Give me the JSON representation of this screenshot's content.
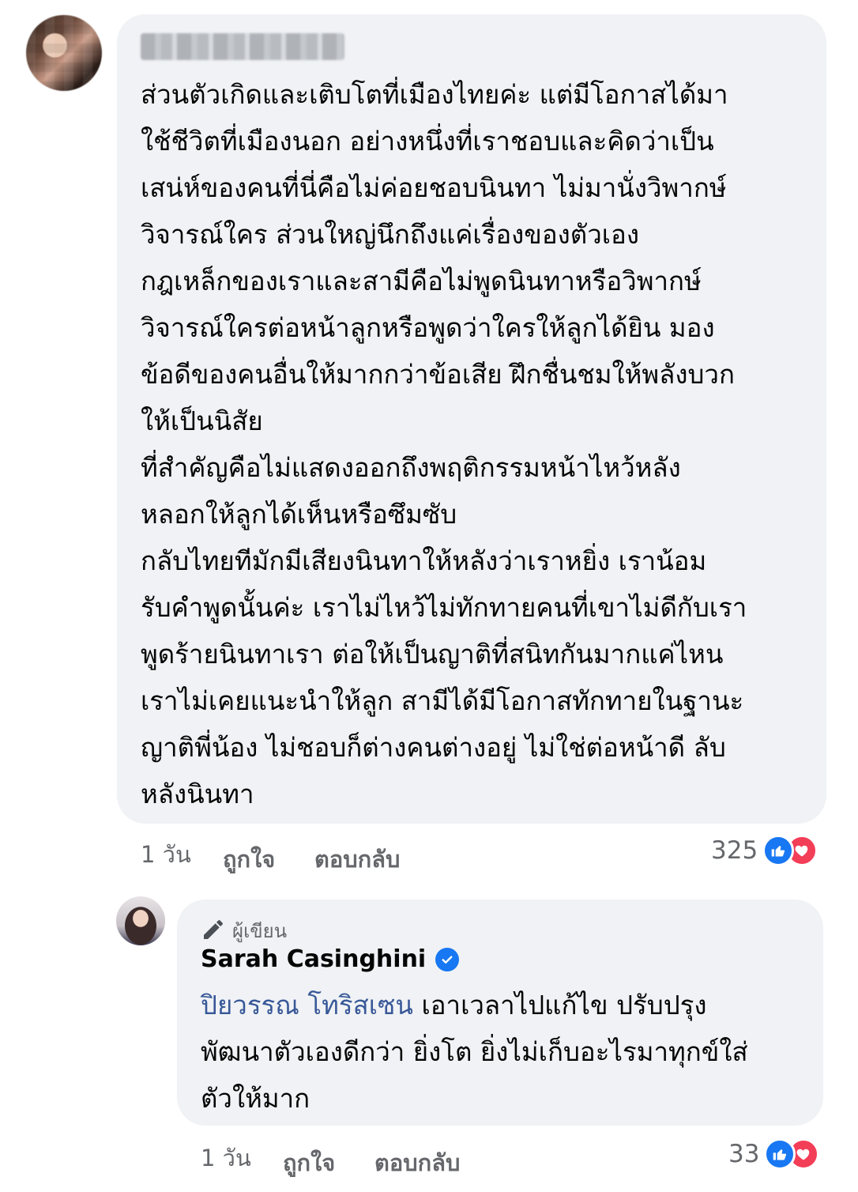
{
  "comment": {
    "author_name_blurred": "",
    "text": "ส่วนตัวเกิดและเติบโตที่เมืองไทยค่ะ แต่มีโอกาสได้มา\nใช้ชีวิตที่เมืองนอก อย่างหนึ่งที่เราชอบและคิดว่าเป็น\nเสน่ห์ของคนที่นี่คือไม่ค่อยชอบนินทา ไม่มานั่งวิพากษ์\nวิจารณ์ใคร ส่วนใหญ่นึกถึงแค่เรื่องของตัวเอง\nกฎเหล็กของเราและสามีคือไม่พูดนินทาหรือวิพากษ์\nวิจารณ์ใครต่อหน้าลูกหรือพูดว่าใครให้ลูกได้ยิน มอง\nข้อดีของคนอื่นให้มากกว่าข้อเสีย ฝึกชื่นชมให้พลังบวก\nให้เป็นนิสัย\nที่สำคัญคือไม่แสดงออกถึงพฤติกรรมหน้าไหว้หลัง\nหลอกให้ลูกได้เห็นหรือซึมซับ\nกลับไทยทีมักมีเสียงนินทาให้หลังว่าเราหยิ่ง เราน้อม\nรับคำพูดนั้นค่ะ เราไม่ไหว้ไม่ทักทายคนที่เขาไม่ดีกับเรา\nพูดร้ายนินทาเรา ต่อให้เป็นญาติที่สนิทกันมากแค่ไหน\nเราไม่เคยแนะนำให้ลูก สามีได้มีโอกาสทักทายในฐานะ\nญาติพี่น้อง ไม่ชอบก็ต่างคนต่างอยู่ ไม่ใช่ต่อหน้าดี ลับ\nหลังนินทา",
    "time": "1 วัน",
    "like_label": "ถูกใจ",
    "reply_label": "ตอบกลับ",
    "reaction_count": "325"
  },
  "reply": {
    "badge_label": "ผู้เขียน",
    "author": "Sarah Casinghini",
    "mention": "ปิยวรรณ โทริสเซน",
    "text": "  เอาเวลาไปแก้ไข ปรับปรุง\nพัฒนาตัวเองดีกว่า ยิ่งโต ยิ่งไม่เก็บอะไรมาทุกข์ใส่\nตัวให้มาก",
    "time": "1 วัน",
    "like_label": "ถูกใจ",
    "reply_label": "ตอบกลับ",
    "reaction_count": "33"
  },
  "colors": {
    "like": "#1877f2",
    "love": "#f33e58",
    "bubble": "#f0f2f5",
    "mention": "#385898"
  }
}
